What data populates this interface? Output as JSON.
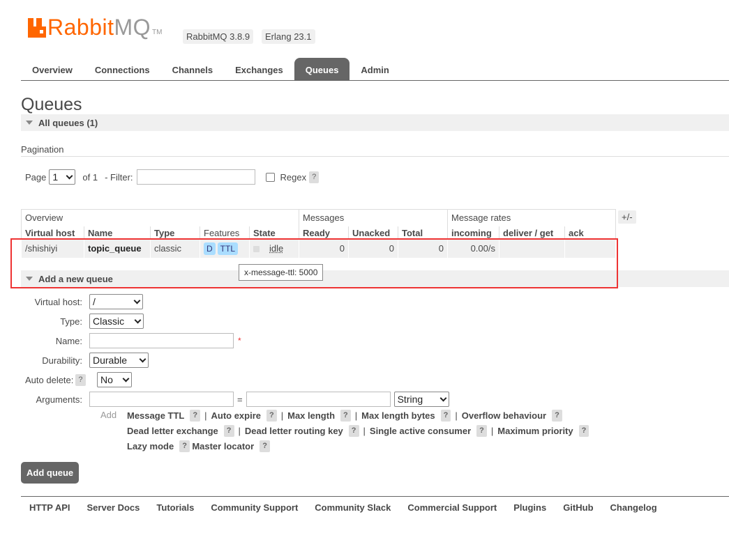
{
  "header": {
    "logo_brand": "Rabbit",
    "logo_mq": "MQ",
    "logo_tm": "TM",
    "version_rabbit": "RabbitMQ 3.8.9",
    "version_erlang": "Erlang 23.1"
  },
  "tabs": [
    {
      "label": "Overview",
      "active": false
    },
    {
      "label": "Connections",
      "active": false
    },
    {
      "label": "Channels",
      "active": false
    },
    {
      "label": "Exchanges",
      "active": false
    },
    {
      "label": "Queues",
      "active": true
    },
    {
      "label": "Admin",
      "active": false
    }
  ],
  "page": {
    "title": "Queues",
    "all_queues_label": "All queues (1)",
    "pagination_label": "Pagination",
    "page_label": "Page",
    "page_value": "1",
    "of_label": "of 1",
    "filter_label": "- Filter:",
    "filter_value": "",
    "regex_label": "Regex",
    "help_mark": "?"
  },
  "table": {
    "groups": [
      "Overview",
      "Messages",
      "Message rates"
    ],
    "plus_minus": "+/-",
    "columns": [
      "Virtual host",
      "Name",
      "Type",
      "Features",
      "State",
      "Ready",
      "Unacked",
      "Total",
      "incoming",
      "deliver / get",
      "ack"
    ],
    "row": {
      "vhost": "/shishiyi",
      "name": "topic_queue",
      "type": "classic",
      "feature_d": "D",
      "feature_ttl": "TTL",
      "state": "idle",
      "ready": "0",
      "unacked": "0",
      "total": "0",
      "incoming": "0.00/s",
      "deliver_get": "",
      "ack": ""
    },
    "tooltip": "x-message-ttl: 5000"
  },
  "add_queue": {
    "section_label": "Add a new queue",
    "vhost_label": "Virtual host:",
    "vhost_value": "/",
    "type_label": "Type:",
    "type_value": "Classic",
    "name_label": "Name:",
    "name_value": "",
    "required_mark": "*",
    "durability_label": "Durability:",
    "durability_value": "Durable",
    "autodelete_label": "Auto delete:",
    "autodelete_value": "No",
    "arguments_label": "Arguments:",
    "args_equals": "=",
    "args_type_value": "String",
    "add_label": "Add",
    "arg_links_row1": [
      "Message TTL",
      "Auto expire",
      "Max length",
      "Max length bytes",
      "Overflow behaviour"
    ],
    "arg_links_row2": [
      "Dead letter exchange",
      "Dead letter routing key",
      "Single active consumer",
      "Maximum priority"
    ],
    "arg_links_row3": [
      "Lazy mode",
      "Master locator"
    ],
    "separator": "|",
    "submit_label": "Add queue"
  },
  "footer": [
    "HTTP API",
    "Server Docs",
    "Tutorials",
    "Community Support",
    "Community Slack",
    "Commercial Support",
    "Plugins",
    "GitHub",
    "Changelog"
  ],
  "colors": {
    "brand": "#ff6600",
    "tab_active": "#666666",
    "highlight_box": "#ee3333",
    "feature_badge": "#aaddff"
  }
}
